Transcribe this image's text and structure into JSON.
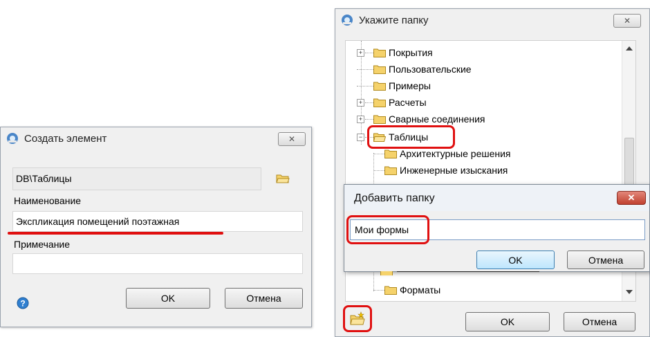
{
  "create_dialog": {
    "title": "Создать элемент",
    "path_value": "DB\\Таблицы",
    "name_label": "Наименование",
    "name_value": "Экспликация помещений поэтажная",
    "note_label": "Примечание",
    "note_value": "",
    "ok_label": "OK",
    "cancel_label": "Отмена"
  },
  "folder_dialog": {
    "title": "Укажите папку",
    "tree_items": [
      {
        "label": "Покрытия",
        "expander": "+"
      },
      {
        "label": "Пользовательские",
        "expander": ""
      },
      {
        "label": "Примеры",
        "expander": ""
      },
      {
        "label": "Расчеты",
        "expander": "+"
      },
      {
        "label": "Сварные соединения",
        "expander": "+"
      },
      {
        "label": "Таблицы",
        "expander": "-"
      },
      {
        "label": "Архитектурные решения",
        "expander": ""
      },
      {
        "label": "Инженерные изыскания",
        "expander": ""
      },
      {
        "label": "Формаτы",
        "expander": ""
      }
    ],
    "ok_label": "OK",
    "cancel_label": "Отмена"
  },
  "add_folder_dialog": {
    "title": "Добавить папку",
    "input_value": "Мои формы",
    "ok_label": "OK",
    "cancel_label": "Отмена"
  },
  "colors": {
    "highlight": "#e01010",
    "folder": "#f5d26b",
    "close_red": "#c9473a"
  }
}
